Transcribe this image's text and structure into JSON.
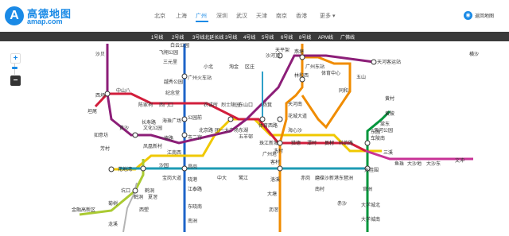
{
  "brand": {
    "name_cn": "高德地图",
    "name_en": "amap.com",
    "mark": "A"
  },
  "cities": [
    "北京",
    "上海",
    "广州",
    "深圳",
    "武汉",
    "天津",
    "南京",
    "香港"
  ],
  "active_city": "广州",
  "more_label": "更多",
  "back_label": "返回地图",
  "lines": [
    "1号线",
    "2号线",
    "3号线北延长线",
    "3号线",
    "4号线",
    "5号线",
    "6号线",
    "8号线",
    "APM线",
    "广佛线"
  ],
  "zoom": {
    "in": "+",
    "out": "−"
  },
  "stations": [
    "白云公园",
    "飞翔公园",
    "三元里",
    "广州火车站",
    "小北",
    "淘金",
    "区庄",
    "天平架",
    "燕塘",
    "天河客运站",
    "沙贝",
    "沙河顶",
    "广州东站",
    "林和西",
    "体育中心",
    "五山",
    "同和",
    "横沙",
    "黄陂",
    "员村",
    "中山八",
    "西场",
    "越秀公园",
    "纪念堂",
    "陈家祠",
    "西门口",
    "农讲所",
    "烈士陵园",
    "东山口",
    "杨箕",
    "体育西路",
    "天河南",
    "黄村",
    "坦尾",
    "长寿路",
    "海珠广场",
    "公园前",
    "北京路",
    "团一大广场",
    "东湖",
    "五羊邨",
    "珠江新城",
    "猎德",
    "潭村",
    "员村",
    "科韵路",
    "车陂南",
    "东圃",
    "三溪",
    "鱼珠",
    "大沙地",
    "大沙东",
    "文冲",
    "如意坊",
    "芳村",
    "黄沙",
    "一德路",
    "文化公园",
    "江南西",
    "市二宫",
    "凤凰新村",
    "晓港",
    "中大",
    "鹭江",
    "客村",
    "赤岗",
    "磨碟沙",
    "新港东",
    "琶洲",
    "万胜围",
    "花地湾",
    "沙园",
    "宝岗大道",
    "昌岗",
    "江泰路",
    "东晓南",
    "南洲",
    "洛溪",
    "大塘",
    "沥滘",
    "鹤洞",
    "西塱",
    "坑口",
    "菊树",
    "龙溪",
    "金融高新区",
    "冼村",
    "大学城北",
    "官洲",
    "夏滘",
    "天河公园",
    "棠东",
    "南村",
    "大学城南",
    "花城大道",
    "海心沙",
    "广州塔",
    "赤沙",
    "鹤洞"
  ]
}
